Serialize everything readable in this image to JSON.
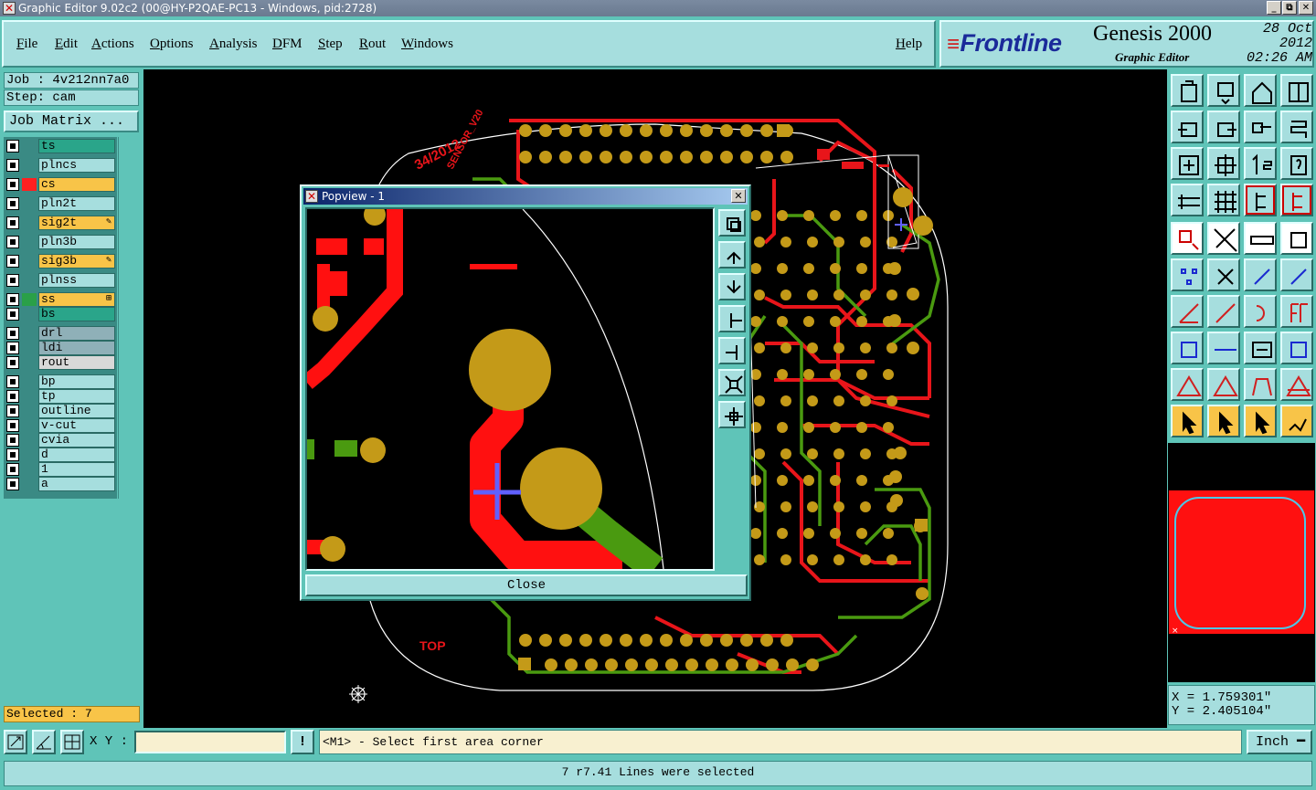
{
  "window": {
    "title": "Graphic Editor 9.02c2 (00@HY-P2QAE-PC13 - Windows, pid:2728)",
    "controls": [
      "_",
      "⧉",
      "✕"
    ]
  },
  "menu": {
    "items": [
      "File",
      "Edit",
      "Actions",
      "Options",
      "Analysis",
      "DFM",
      "Step",
      "Rout",
      "Windows"
    ],
    "help": "Help"
  },
  "brand": {
    "logo": "Frontline",
    "product": "Genesis 2000",
    "subtitle": "Graphic Editor",
    "date": "28 Oct 2012",
    "time": "02:26 AM"
  },
  "job": {
    "job_label": "Job : 4v212nn7a0",
    "step_label": "Step: cam",
    "matrix_button": "Job Matrix ..."
  },
  "layers": [
    {
      "name": "ts",
      "color": "#2aa58a",
      "mark": ""
    },
    {
      "name": "plncs",
      "color": "#a6dede",
      "mark": ""
    },
    {
      "name": "cs",
      "color": "#f8c448",
      "mark": "#ff2020"
    },
    {
      "name": "pln2t",
      "color": "#a6dede",
      "mark": ""
    },
    {
      "name": "sig2t",
      "color": "#f8c448",
      "mark": "",
      "flag": "✎"
    },
    {
      "name": "pln3b",
      "color": "#a6dede",
      "mark": ""
    },
    {
      "name": "sig3b",
      "color": "#f8c448",
      "mark": "",
      "flag": "✎"
    },
    {
      "name": "plnss",
      "color": "#a6dede",
      "mark": ""
    },
    {
      "name": "ss",
      "color": "#f8c448",
      "mark": "#2aa048",
      "flag": "⊞"
    },
    {
      "name": "bs",
      "color": "#2aa58a",
      "mark": ""
    },
    {
      "name": "drl",
      "color": "#8fb0b8",
      "mark": ""
    },
    {
      "name": "ldi",
      "color": "#8fb0b8",
      "mark": ""
    },
    {
      "name": "rout",
      "color": "#d8d8d8",
      "mark": ""
    },
    {
      "name": "bp",
      "color": "#a6dede",
      "mark": ""
    },
    {
      "name": "tp",
      "color": "#a6dede",
      "mark": ""
    },
    {
      "name": "outline",
      "color": "#a6dede",
      "mark": ""
    },
    {
      "name": "v-cut",
      "color": "#a6dede",
      "mark": ""
    },
    {
      "name": "cvia",
      "color": "#a6dede",
      "mark": ""
    },
    {
      "name": "d",
      "color": "#a6dede",
      "mark": ""
    },
    {
      "name": "1",
      "color": "#a6dede",
      "mark": ""
    },
    {
      "name": "a",
      "color": "#a6dede",
      "mark": ""
    }
  ],
  "selected": "Selected : 7",
  "board": {
    "text_top": "TOP",
    "text_date": "34/2012",
    "text_sensor": "SENSOR_V20",
    "colors": {
      "cs": "#e8151a",
      "ss": "#4a9a10",
      "pad": "#c49a18",
      "outline": "#ffffff"
    }
  },
  "popview": {
    "title": "Popview - 1",
    "close_label": "Close",
    "tools": [
      "zoom-fit-icon",
      "pan-up-icon",
      "pan-down-icon",
      "pan-left-icon",
      "pan-right-icon",
      "zoom-in-icon",
      "zoom-out-icon"
    ]
  },
  "coords": {
    "x": "X = 1.759301\"",
    "y": "Y = 2.405104\""
  },
  "bottom": {
    "xy_label": "X Y :",
    "xy_value": "",
    "alert": "!",
    "prompt": "<M1> - Select first area corner",
    "unit": "Inch",
    "status": "7 r7.41 Lines were selected"
  },
  "tools": [
    "clipboard-up-icon",
    "clipboard-down-icon",
    "home-icon",
    "window-split-icon",
    "arrow-left-icon",
    "arrow-right-icon",
    "swap-icon",
    "mirror-icon",
    "zoom-fit-icon",
    "zoom-center-icon",
    "scale-1to2-icon",
    "query-icon",
    "layer-tool-icon",
    "grid-icon",
    "snap-icon",
    "snap-alt-icon",
    "select-pad-icon",
    "measure-icon",
    "ruler-icon",
    "round-pad-icon",
    "connect-icon",
    "cross-icon",
    "add-line-icon",
    "add-line-alt-icon",
    "edit-angle-icon",
    "draw-line-icon",
    "arc-icon",
    "ff-icon",
    "add-via-icon",
    "trace-icon",
    "dimension-icon",
    "group-icon",
    "triangle-icon",
    "triangle-alt-icon",
    "trapezoid-icon",
    "triangle-marked-icon",
    "pointer-icon",
    "pointer-box-icon",
    "pointer-frame-icon",
    "route-icon"
  ]
}
